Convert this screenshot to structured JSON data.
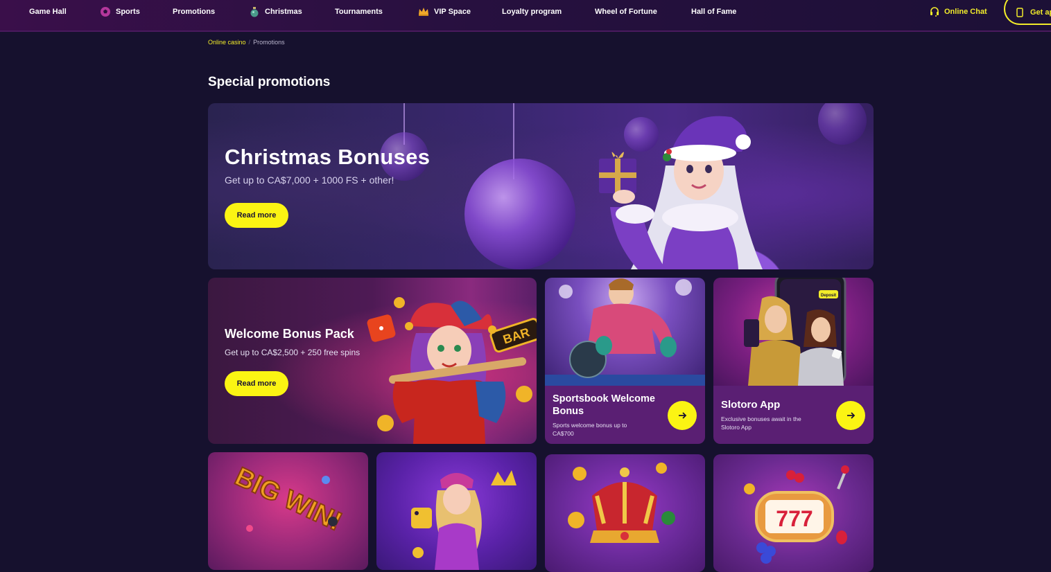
{
  "nav": {
    "items": [
      {
        "label": "Game Hall",
        "icon": ""
      },
      {
        "label": "Sports",
        "icon": "soccer-ball-icon"
      },
      {
        "label": "Promotions",
        "icon": ""
      },
      {
        "label": "Christmas",
        "icon": "christmas-ornament-icon"
      },
      {
        "label": "Tournaments",
        "icon": ""
      },
      {
        "label": "VIP Space",
        "icon": "crown-icon"
      },
      {
        "label": "Loyalty program",
        "icon": ""
      },
      {
        "label": "Wheel of Fortune",
        "icon": ""
      },
      {
        "label": "Hall of Fame",
        "icon": ""
      }
    ],
    "chat_label": "Online Chat",
    "get_app_label": "Get app"
  },
  "breadcrumb": {
    "root": "Online casino",
    "separator": "/",
    "current": "Promotions"
  },
  "page_title": "Special promotions",
  "hero": {
    "title": "Christmas Bonuses",
    "subtitle": "Get up to CA$7,000 + 1000 FS + other!",
    "button": "Read more"
  },
  "welcome": {
    "title": "Welcome Bonus Pack",
    "subtitle": "Get up to CA$2,500 + 250 free spins",
    "button": "Read more",
    "bar_sign": "BAR"
  },
  "sportsbook": {
    "title": "Sportsbook Welcome Bonus",
    "subtitle": "Sports welcome bonus up to CA$700"
  },
  "app_card": {
    "title": "Slotoro App",
    "subtitle": "Exclusive bonuses await in the Slotoro App",
    "phone_button": "Deposit"
  },
  "tiles": {
    "big_win": "BIG WIN!",
    "slot_digits": "777"
  },
  "colors": {
    "accent": "#fbf413",
    "background": "#16112e",
    "card_footer": "#5a1f73"
  }
}
